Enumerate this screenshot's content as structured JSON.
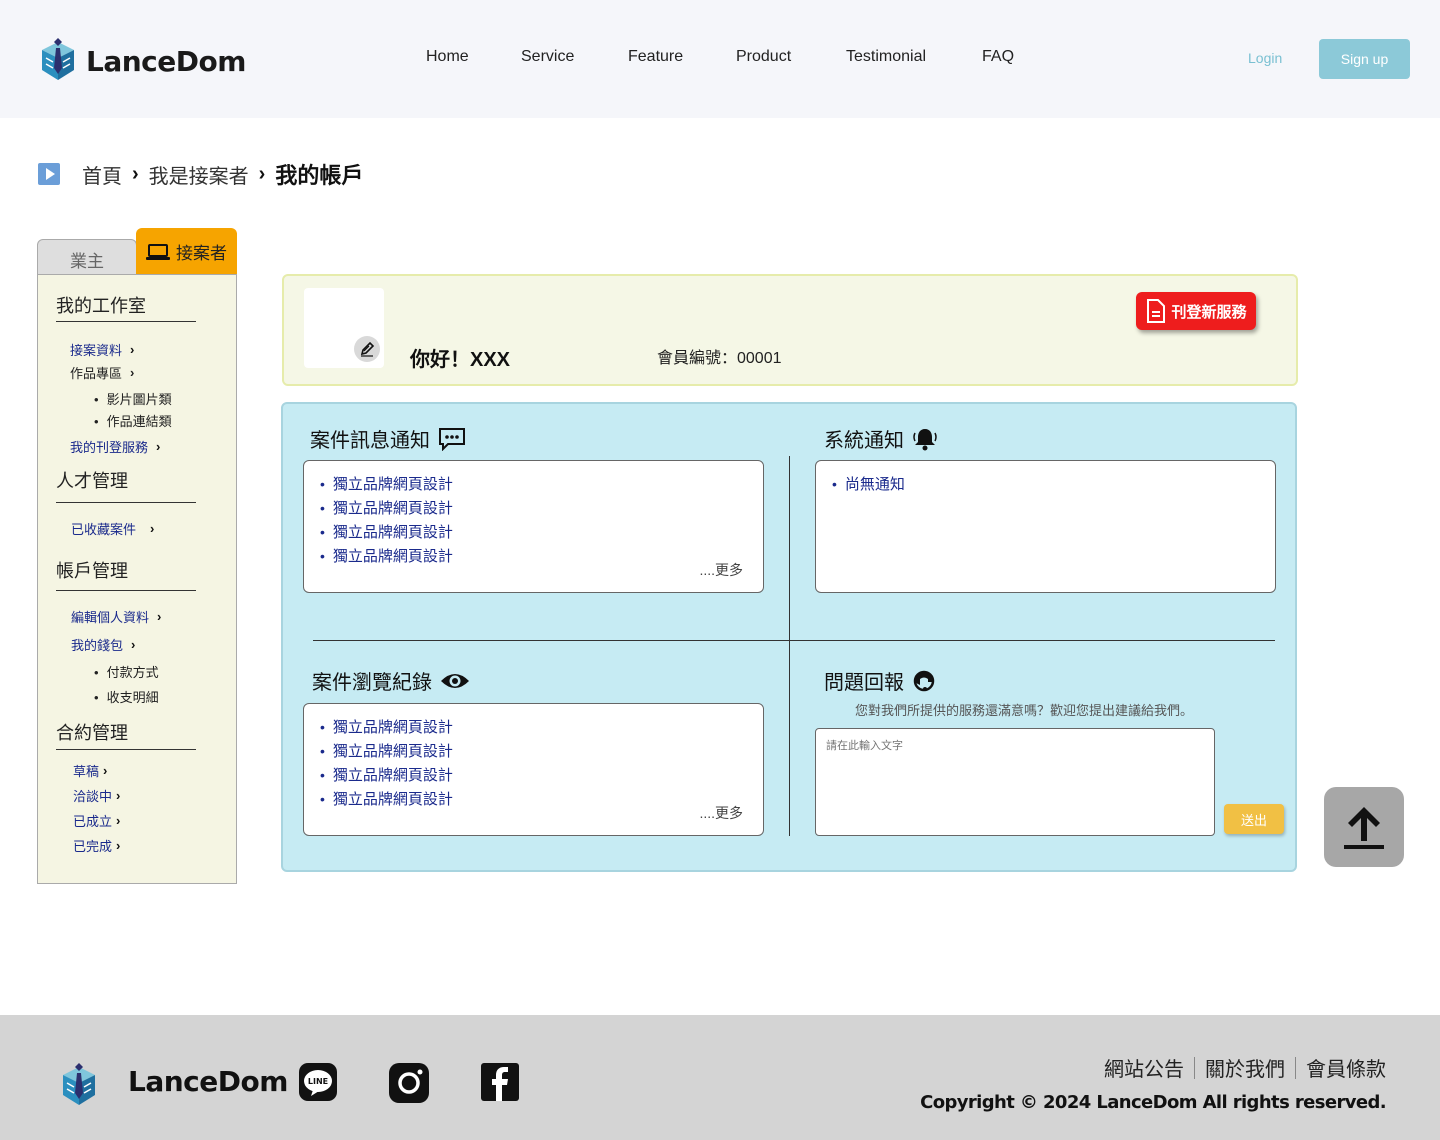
{
  "header": {
    "brand": "LanceDom",
    "nav": [
      "Home",
      "Service",
      "Feature",
      "Product",
      "Testimonial",
      "FAQ"
    ],
    "login_label": "Login",
    "signup_label": "Sign up"
  },
  "breadcrumb": {
    "items": [
      "首頁",
      "我是接案者"
    ],
    "current": "我的帳戶"
  },
  "sidebar": {
    "tabs": {
      "employer": "業主",
      "freelancer": "接案者"
    },
    "sections": {
      "workspace": {
        "title": "我的工作室",
        "links": [
          "接案資料",
          "作品專區",
          "我的刊登服務"
        ],
        "portfolio_subitems": [
          "影片圖片類",
          "作品連結類"
        ]
      },
      "talent": {
        "title": "人才管理",
        "links": [
          "已收藏案件"
        ]
      },
      "account": {
        "title": "帳戶管理",
        "links": [
          "編輯個人資料",
          "我的錢包"
        ],
        "wallet_subitems": [
          "付款方式",
          "收支明細"
        ]
      },
      "contract": {
        "title": "合約管理",
        "links": [
          "草稿",
          "洽談中",
          "已成立",
          "已完成"
        ]
      }
    }
  },
  "profile": {
    "greeting": "你好！XXX",
    "member_no": "會員編號：00001",
    "post_button": "刊登新服務"
  },
  "dashboard": {
    "case_messages": {
      "title": "案件訊息通知",
      "items": [
        "獨立品牌網頁設計",
        "獨立品牌網頁設計",
        "獨立品牌網頁設計",
        "獨立品牌網頁設計"
      ],
      "more": "....更多"
    },
    "system_notice": {
      "title": "系統通知",
      "items": [
        "尚無通知"
      ]
    },
    "browse_history": {
      "title": "案件瀏覽紀錄",
      "items": [
        "獨立品牌網頁設計",
        "獨立品牌網頁設計",
        "獨立品牌網頁設計",
        "獨立品牌網頁設計"
      ],
      "more": "....更多"
    },
    "feedback": {
      "title": "問題回報",
      "tip": "您對我們所提供的服務還滿意嗎？歡迎您提出建議給我們。",
      "placeholder": "請在此輸入文字",
      "send": "送出"
    }
  },
  "footer": {
    "brand": "LanceDom",
    "links": [
      "網站公告",
      "關於我們",
      "會員條款"
    ],
    "copyright": "Copyright © 2024 LanceDom All rights reserved.",
    "social": [
      "line-icon",
      "instagram-icon",
      "facebook-icon"
    ]
  },
  "colors": {
    "accent_tab": "#f6a400",
    "post_button": "#ee1d1d",
    "dashboard_bg": "#c6ebf3",
    "send_button": "#f1c044",
    "signup_button": "#8cc9d8"
  }
}
